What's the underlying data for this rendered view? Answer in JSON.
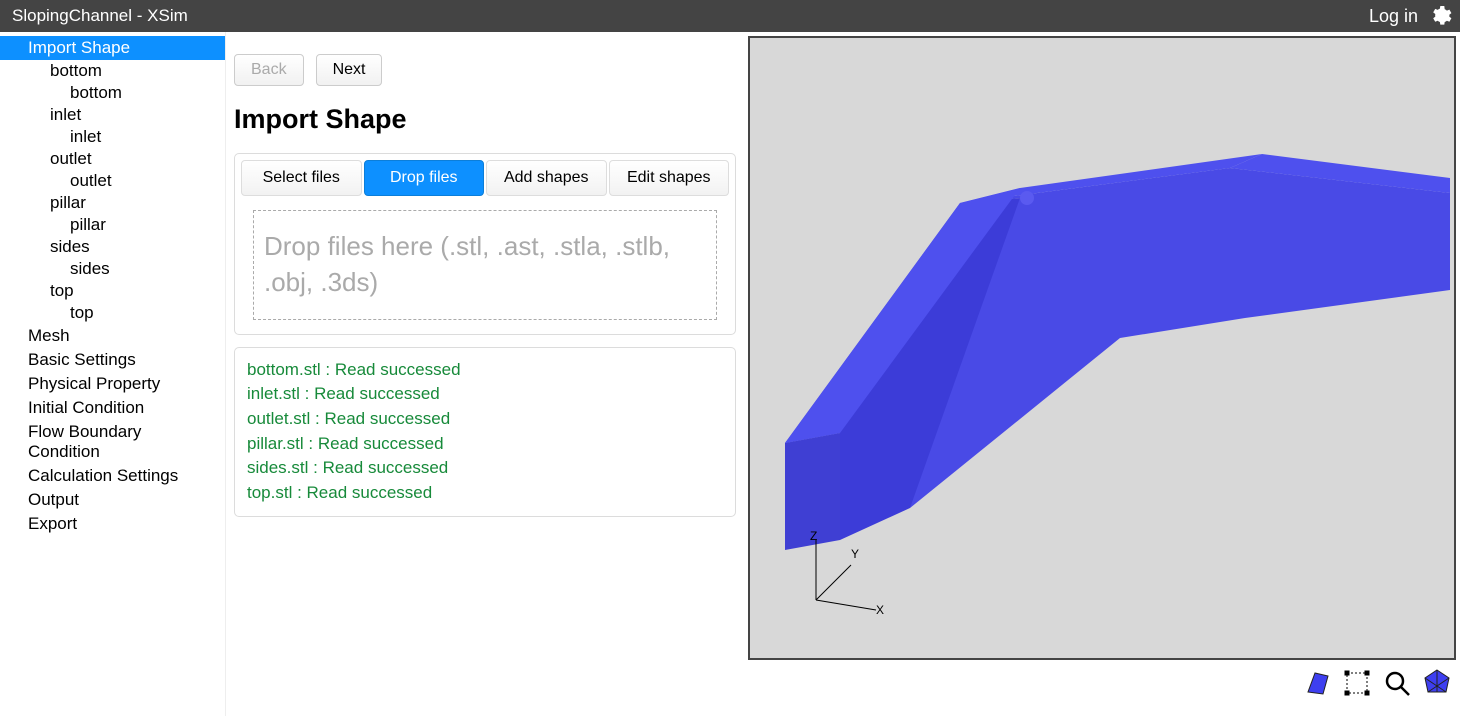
{
  "window": {
    "title": "SlopingChannel - XSim",
    "login": "Log in"
  },
  "sidebar": {
    "items": [
      {
        "label": "Import Shape",
        "level": 1,
        "active": true
      },
      {
        "label": "bottom",
        "level": 2
      },
      {
        "label": "bottom",
        "level": 3
      },
      {
        "label": "inlet",
        "level": 2
      },
      {
        "label": "inlet",
        "level": 3
      },
      {
        "label": "outlet",
        "level": 2
      },
      {
        "label": "outlet",
        "level": 3
      },
      {
        "label": "pillar",
        "level": 2
      },
      {
        "label": "pillar",
        "level": 3
      },
      {
        "label": "sides",
        "level": 2
      },
      {
        "label": "sides",
        "level": 3
      },
      {
        "label": "top",
        "level": 2
      },
      {
        "label": "top",
        "level": 3
      },
      {
        "label": "Mesh",
        "level": 1
      },
      {
        "label": "Basic Settings",
        "level": 1
      },
      {
        "label": "Physical Property",
        "level": 1
      },
      {
        "label": "Initial Condition",
        "level": 1
      },
      {
        "label": "Flow Boundary Condition",
        "level": 1
      },
      {
        "label": "Calculation Settings",
        "level": 1
      },
      {
        "label": "Output",
        "level": 1
      },
      {
        "label": "Export",
        "level": 1
      }
    ]
  },
  "nav": {
    "back": "Back",
    "next": "Next"
  },
  "panel": {
    "heading": "Import Shape",
    "tabs": [
      {
        "label": "Select files"
      },
      {
        "label": "Drop files",
        "active": true
      },
      {
        "label": "Add shapes"
      },
      {
        "label": "Edit shapes"
      }
    ],
    "dropzone": "Drop files here (.stl, .ast, .stla, .stlb, .obj, .3ds)"
  },
  "log": [
    "bottom.stl : Read successed",
    "inlet.stl : Read successed",
    "outlet.stl : Read successed",
    "pillar.stl : Read successed",
    "sides.stl : Read successed",
    "top.stl : Read successed"
  ],
  "axes": {
    "x": "X",
    "y": "Y",
    "z": "Z"
  }
}
